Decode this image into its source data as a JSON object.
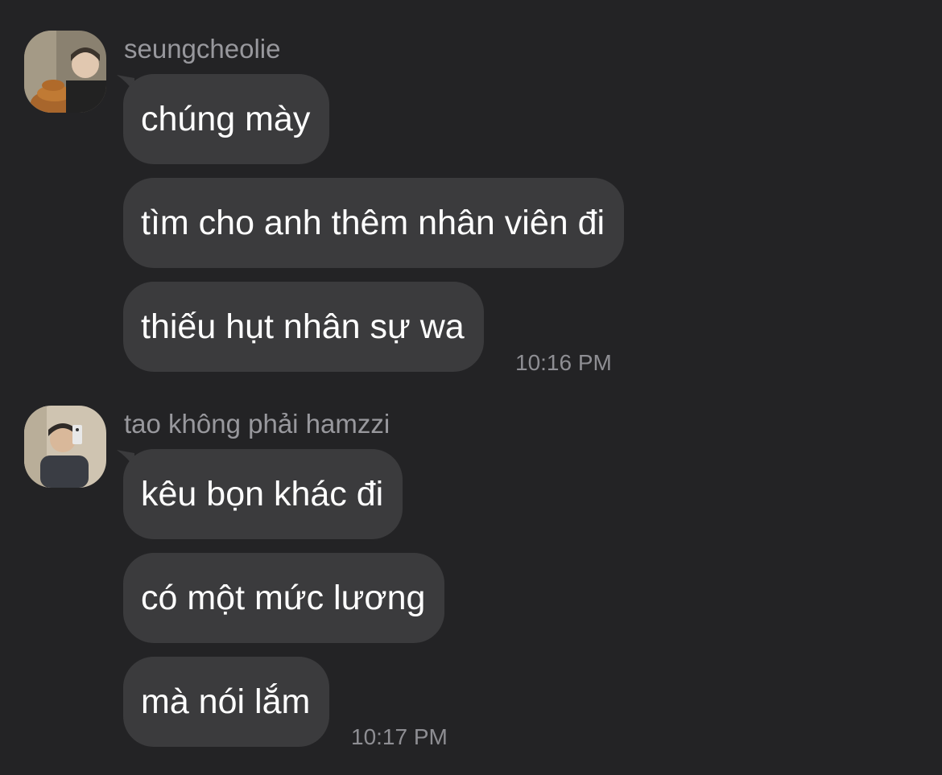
{
  "conversation": {
    "groups": [
      {
        "sender": "seungcheolie",
        "avatar_icon": "user-avatar-photo",
        "messages": [
          {
            "text": "chúng mày"
          },
          {
            "text": "tìm cho anh thêm nhân viên đi"
          },
          {
            "text": "thiếu hụt nhân sự wa"
          }
        ],
        "timestamp": "10:16 PM"
      },
      {
        "sender": "tao không phải hamzzi",
        "avatar_icon": "user-avatar-photo",
        "messages": [
          {
            "text": "kêu bọn khác đi"
          },
          {
            "text": "có một mức lương"
          },
          {
            "text": "mà nói lắm"
          }
        ],
        "timestamp": "10:17 PM"
      }
    ]
  },
  "colors": {
    "background": "#232325",
    "bubble": "#3b3b3d",
    "message_text": "#ffffff",
    "meta_text": "#98989d"
  }
}
